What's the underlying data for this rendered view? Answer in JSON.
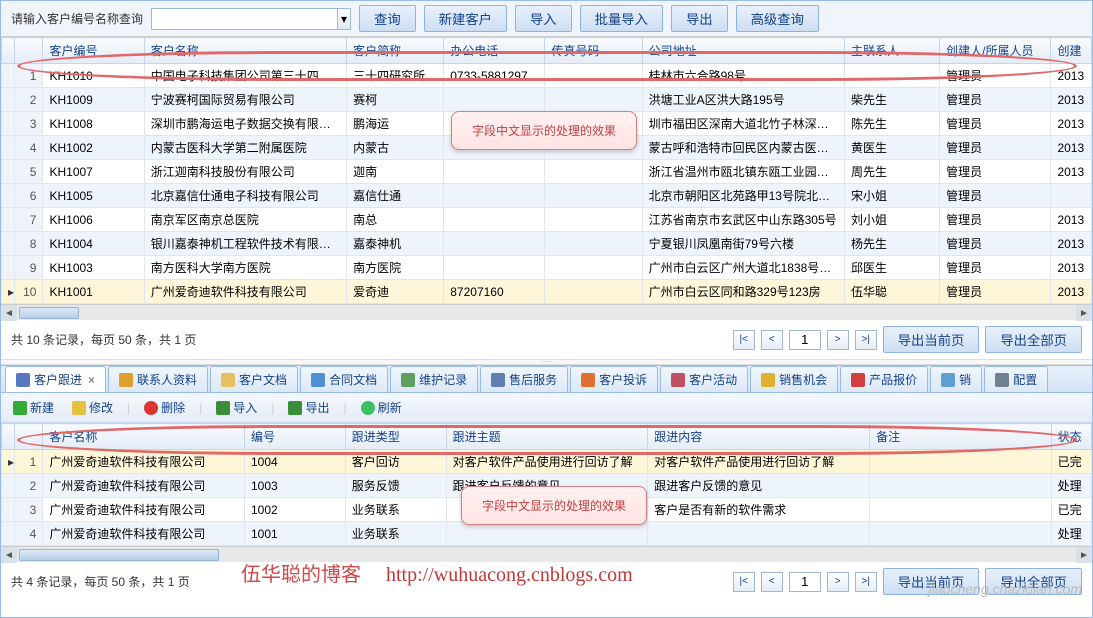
{
  "toolbar": {
    "search_label": "请输入客户编号名称查询",
    "search_value": "",
    "query_btn": "查询",
    "new_btn": "新建客户",
    "import_btn": "导入",
    "batch_import_btn": "批量导入",
    "export_btn": "导出",
    "adv_query_btn": "高级查询"
  },
  "grid1": {
    "headers": {
      "id": "客户编号",
      "name": "客户名称",
      "short": "客户简称",
      "tel": "办公电话",
      "fax": "传真号码",
      "addr": "公司地址",
      "contact": "主联系人",
      "creator": "创建人/所属人员",
      "ctime": "创建"
    },
    "rows": [
      {
        "n": "1",
        "id": "KH1010",
        "name": "中国电子科技集团公司第三十四研…",
        "short": "三十四研究所",
        "tel": "0733-5881297",
        "fax": "",
        "addr": "桂林市六合路98号",
        "contact": "",
        "creator": "管理员",
        "ctime": "2013"
      },
      {
        "n": "2",
        "id": "KH1009",
        "name": "宁波赛柯国际贸易有限公司",
        "short": "赛柯",
        "tel": "",
        "fax": "",
        "addr": "洪塘工业A区洪大路195号",
        "contact": "柴先生",
        "creator": "管理员",
        "ctime": "2013"
      },
      {
        "n": "3",
        "id": "KH1008",
        "name": "深圳市鹏海运电子数据交换有限公司",
        "short": "鹏海运",
        "tel": "",
        "fax": "",
        "addr": "圳市福田区深南大道北竹子林深…",
        "contact": "陈先生",
        "creator": "管理员",
        "ctime": "2013"
      },
      {
        "n": "4",
        "id": "KH1002",
        "name": "内蒙古医科大学第二附属医院",
        "short": "内蒙古",
        "tel": "",
        "fax": "",
        "addr": "蒙古呼和浩特市回民区内蒙古医…",
        "contact": "黄医生",
        "creator": "管理员",
        "ctime": "2013"
      },
      {
        "n": "5",
        "id": "KH1007",
        "name": "浙江迦南科技股份有限公司",
        "short": "迦南",
        "tel": "",
        "fax": "",
        "addr": "浙江省温州市瓯北镇东瓯工业园…",
        "contact": "周先生",
        "creator": "管理员",
        "ctime": "2013"
      },
      {
        "n": "6",
        "id": "KH1005",
        "name": "北京嘉信仕通电子科技有限公司",
        "short": "嘉信仕通",
        "tel": "",
        "fax": "",
        "addr": "北京市朝阳区北苑路甲13号院北辰…",
        "contact": "宋小姐",
        "creator": "管理员",
        "ctime": ""
      },
      {
        "n": "7",
        "id": "KH1006",
        "name": "南京军区南京总医院",
        "short": "南总",
        "tel": "",
        "fax": "",
        "addr": "江苏省南京市玄武区中山东路305号",
        "contact": "刘小姐",
        "creator": "管理员",
        "ctime": "2013"
      },
      {
        "n": "8",
        "id": "KH1004",
        "name": "银川嘉泰神机工程软件技术有限公司",
        "short": "嘉泰神机",
        "tel": "",
        "fax": "",
        "addr": "宁夏银川凤凰南街79号六楼",
        "contact": "杨先生",
        "creator": "管理员",
        "ctime": "2013"
      },
      {
        "n": "9",
        "id": "KH1003",
        "name": "南方医科大学南方医院",
        "short": "南方医院",
        "tel": "",
        "fax": "",
        "addr": "广州市白云区广州大道北1838号…",
        "contact": "邱医生",
        "creator": "管理员",
        "ctime": "2013"
      },
      {
        "n": "10",
        "id": "KH1001",
        "name": "广州爱奇迪软件科技有限公司",
        "short": "爱奇迪",
        "tel": "87207160",
        "fax": "",
        "addr": "广州市白云区同和路329号123房",
        "contact": "伍华聪",
        "creator": "管理员",
        "ctime": "2013"
      }
    ]
  },
  "pager1": {
    "summary": "共 10 条记录，每页 50 条，共 1 页",
    "page": "1",
    "export_cur": "导出当前页",
    "export_all": "导出全部页"
  },
  "tabs": [
    {
      "label": "客户跟进",
      "active": true,
      "closable": true
    },
    {
      "label": "联系人资料"
    },
    {
      "label": "客户文档"
    },
    {
      "label": "合同文档"
    },
    {
      "label": "维护记录"
    },
    {
      "label": "售后服务"
    },
    {
      "label": "客户投诉"
    },
    {
      "label": "客户活动"
    },
    {
      "label": "销售机会"
    },
    {
      "label": "产品报价"
    },
    {
      "label": "销"
    },
    {
      "label": "配置"
    }
  ],
  "subtoolbar": {
    "new": "新建",
    "edit": "修改",
    "del": "删除",
    "import": "导入",
    "export": "导出",
    "refresh": "刷新"
  },
  "grid2": {
    "headers": {
      "name": "客户名称",
      "no": "编号",
      "type": "跟进类型",
      "subj": "跟进主题",
      "cont": "跟进内容",
      "memo": "备注",
      "stat": "状态"
    },
    "rows": [
      {
        "n": "1",
        "name": "广州爱奇迪软件科技有限公司",
        "no": "1004",
        "type": "客户回访",
        "subj": "对客户软件产品使用进行回访了解",
        "cont": "对客户软件产品使用进行回访了解",
        "memo": "",
        "stat": "已完"
      },
      {
        "n": "2",
        "name": "广州爱奇迪软件科技有限公司",
        "no": "1003",
        "type": "服务反馈",
        "subj": "跟进客户反馈的意见",
        "cont": "跟进客户反馈的意见",
        "memo": "",
        "stat": "处理"
      },
      {
        "n": "3",
        "name": "广州爱奇迪软件科技有限公司",
        "no": "1002",
        "type": "业务联系",
        "subj": "",
        "cont": "客户是否有新的软件需求",
        "memo": "",
        "stat": "已完"
      },
      {
        "n": "4",
        "name": "广州爱奇迪软件科技有限公司",
        "no": "1001",
        "type": "业务联系",
        "subj": "",
        "cont": "",
        "memo": "",
        "stat": "处理"
      }
    ]
  },
  "pager2": {
    "summary": "共 4 条记录，每页 50 条，共 1 页",
    "page": "1",
    "export_cur": "导出当前页",
    "export_all": "导出全部页"
  },
  "callout_text": "字段中文显示的处理的效果",
  "watermark": {
    "cn": "伍华聪的博客",
    "url": "http://wuhuacong.cnblogs.com"
  },
  "footer_wm": "jiaocheng.chazidian.com"
}
